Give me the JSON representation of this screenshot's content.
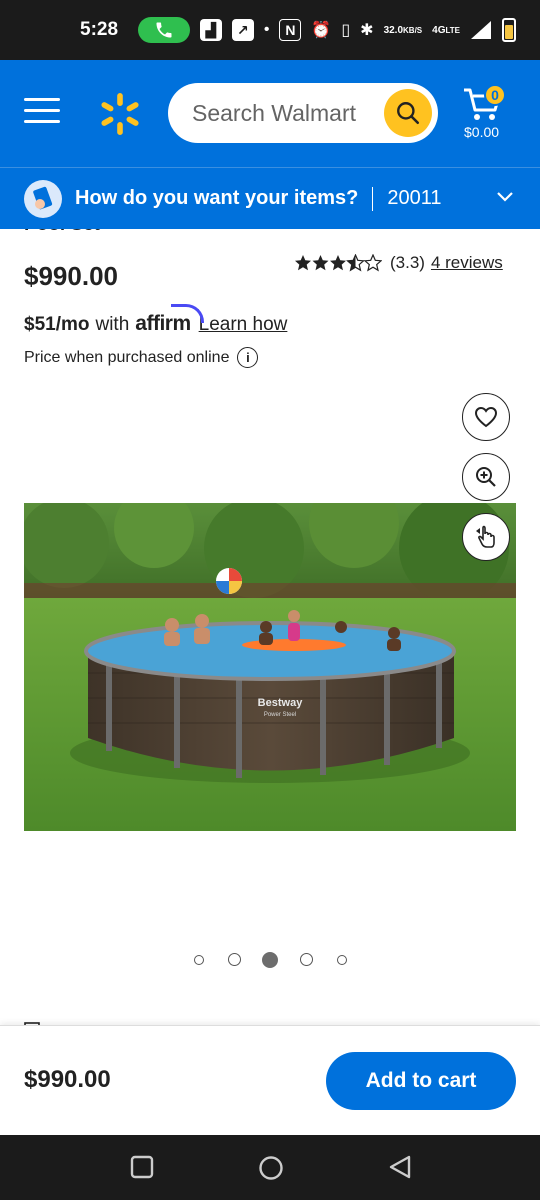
{
  "status_bar": {
    "time": "5:28",
    "speed_value": "32.0",
    "speed_unit": "KB/S",
    "network": "4G",
    "network_sub": "LTE"
  },
  "header": {
    "search_placeholder": "Search Walmart",
    "cart_count": "0",
    "cart_total": "$0.00"
  },
  "fulfillment": {
    "question": "How do you want your items?",
    "zip": "20011"
  },
  "product": {
    "title_fragment": "Pool Set",
    "price": "$990.00",
    "rating_value": "(3.3)",
    "rating_stars": 3.3,
    "reviews_link": "4 reviews",
    "monthly_price": "$51/mo",
    "monthly_with": "with",
    "affirm": "affirm",
    "learn_how": "Learn how",
    "online_note": "Price when purchased online",
    "image_brand": "Bestway",
    "image_sub": "Power Steel"
  },
  "carousel": {
    "total": 5,
    "active_index": 2
  },
  "bottom_bar": {
    "price": "$990.00",
    "add_to_cart": "Add to cart"
  },
  "colors": {
    "brand_blue": "#0071dc",
    "brand_yellow": "#ffc220"
  }
}
